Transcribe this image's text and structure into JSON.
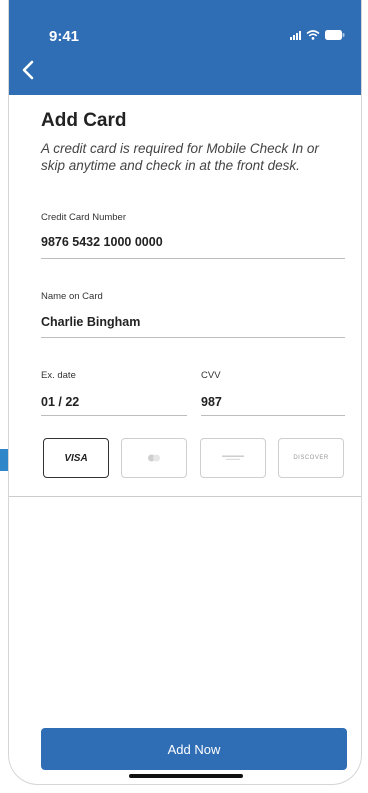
{
  "status_bar": {
    "time": "9:41"
  },
  "nav": {
    "back_icon": "chevron-left-icon"
  },
  "page": {
    "title": "Add Card",
    "subtitle": "A credit card is required for Mobile Check In or skip anytime and check in at the front desk."
  },
  "form": {
    "card_number": {
      "label": "Credit Card Number",
      "value": "9876 5432 1000 0000"
    },
    "name_on_card": {
      "label": "Name on Card",
      "value": "Charlie Bingham"
    },
    "exp_date": {
      "label": "Ex. date",
      "value": "01 / 22"
    },
    "cvv": {
      "label": "CVV",
      "value": "987"
    }
  },
  "card_types": [
    {
      "name": "VISA",
      "selected": true
    },
    {
      "name": "mastercard",
      "selected": false
    },
    {
      "name": "AMERICAN EXPRESS",
      "selected": false
    },
    {
      "name": "DISCOVER",
      "selected": false
    }
  ],
  "actions": {
    "add_now": "Add Now"
  },
  "colors": {
    "primary": "#2f6db5",
    "accent": "#2f86c9"
  }
}
